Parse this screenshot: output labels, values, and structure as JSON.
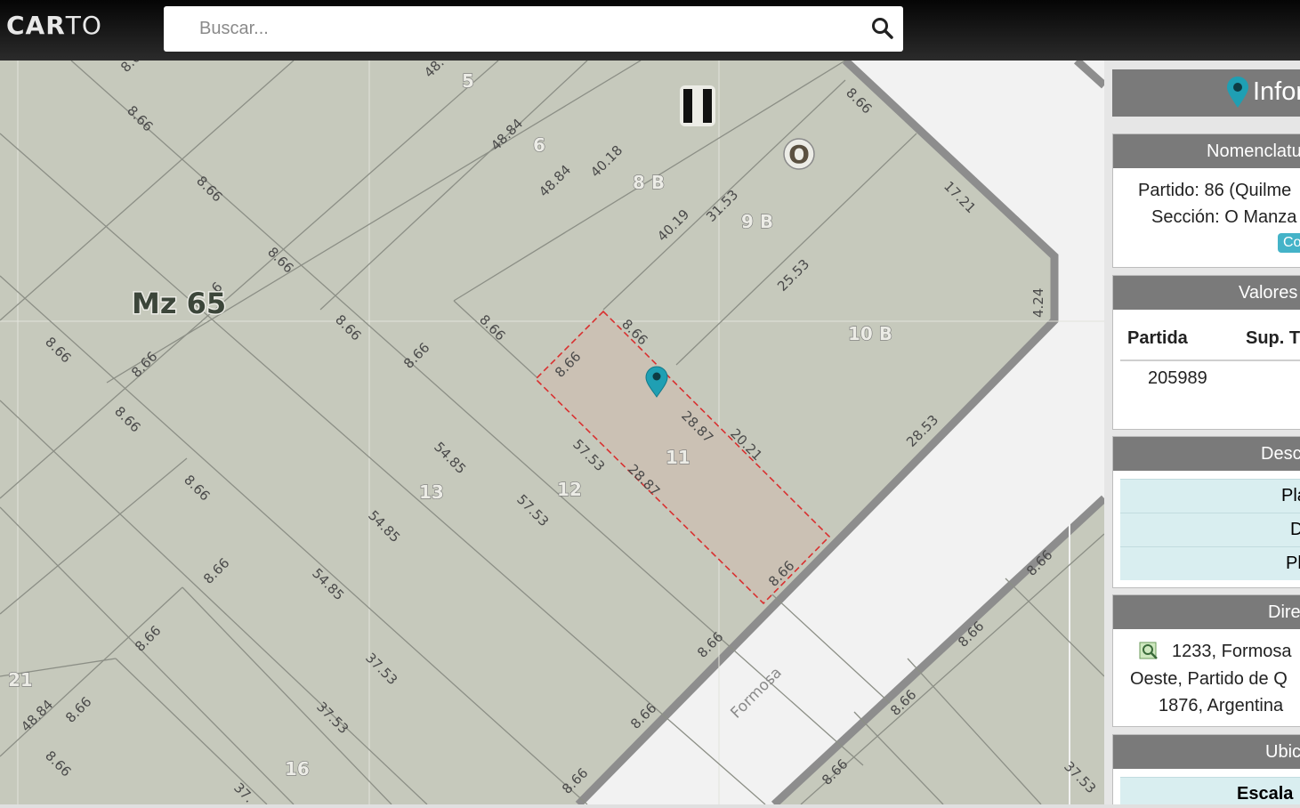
{
  "app": {
    "logo_bold": "CAR",
    "logo_light": "TO"
  },
  "search": {
    "placeholder": "Buscar..."
  },
  "map": {
    "block_label": "Mz 65",
    "street_label": "Formosa",
    "section_marker": "O",
    "pause_icon": "pause-icon",
    "lot_labels": [
      "5",
      "6",
      "8 B",
      "9 B",
      "10 B",
      "11",
      "12",
      "13",
      "16",
      "21"
    ],
    "dimension_labels": [
      "8.66",
      "8.66",
      "8.66",
      "8.66",
      "8.66",
      "8.66",
      "8.66",
      "8.66",
      "8.66",
      "8.66",
      "8.66",
      "8.66",
      "8.66",
      "8.66",
      "8.66",
      "8.66",
      "8.66",
      "8.66",
      "8.66",
      "8.66",
      "8.66",
      "8.66",
      "8.66",
      "8.66",
      "8.66",
      "8.66",
      "8.66",
      "8.66",
      "8.66",
      "48.84",
      "48.84",
      "48.84",
      "40.18",
      "40.19",
      "31.53",
      "25.53",
      "17.21",
      "4.24",
      "28.53",
      "28.87",
      "28.87",
      "20.21",
      "57.53",
      "57.53",
      "54.85",
      "54.85",
      "54.85",
      "37.53",
      "37.53",
      "37.53",
      "48.",
      "6",
      "37."
    ],
    "selected_parcel_color": "#d93030",
    "marker_color": "#1f9fb3"
  },
  "panel": {
    "title": "Infor",
    "nomenclatura": {
      "header": "Nomenclatu",
      "line1": "Partido: 86 (Quilme",
      "line2": "Sección: O Manza",
      "button": "Co"
    },
    "valores": {
      "header": "Valores",
      "col1": "Partida",
      "col2": "Sup. T",
      "partida": "205989"
    },
    "descargas": {
      "header": "Desc",
      "items": [
        "Plan",
        "D",
        "Pla"
      ]
    },
    "direccion": {
      "header": "Dire",
      "line1": "1233, Formosa",
      "line2": "Oeste, Partido de Q",
      "line3": "1876, Argentina"
    },
    "ubicacion": {
      "header": "Ubic",
      "escala": "Escala"
    }
  }
}
